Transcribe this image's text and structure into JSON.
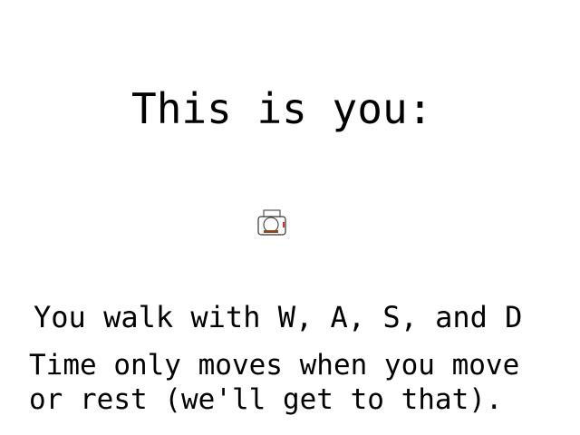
{
  "screen": {
    "title": "This is you:",
    "instructions": {
      "walk": "You walk with W, A, S, and D",
      "time_line1": "Time only moves when you move",
      "time_line2": "or rest (we'll get to that)."
    },
    "player_sprite": {
      "icon": "player-character-icon",
      "colors": {
        "outline": "#333333",
        "body": "#ffffff",
        "hair": "#8b4a1c",
        "accent": "#cc3333"
      }
    }
  }
}
